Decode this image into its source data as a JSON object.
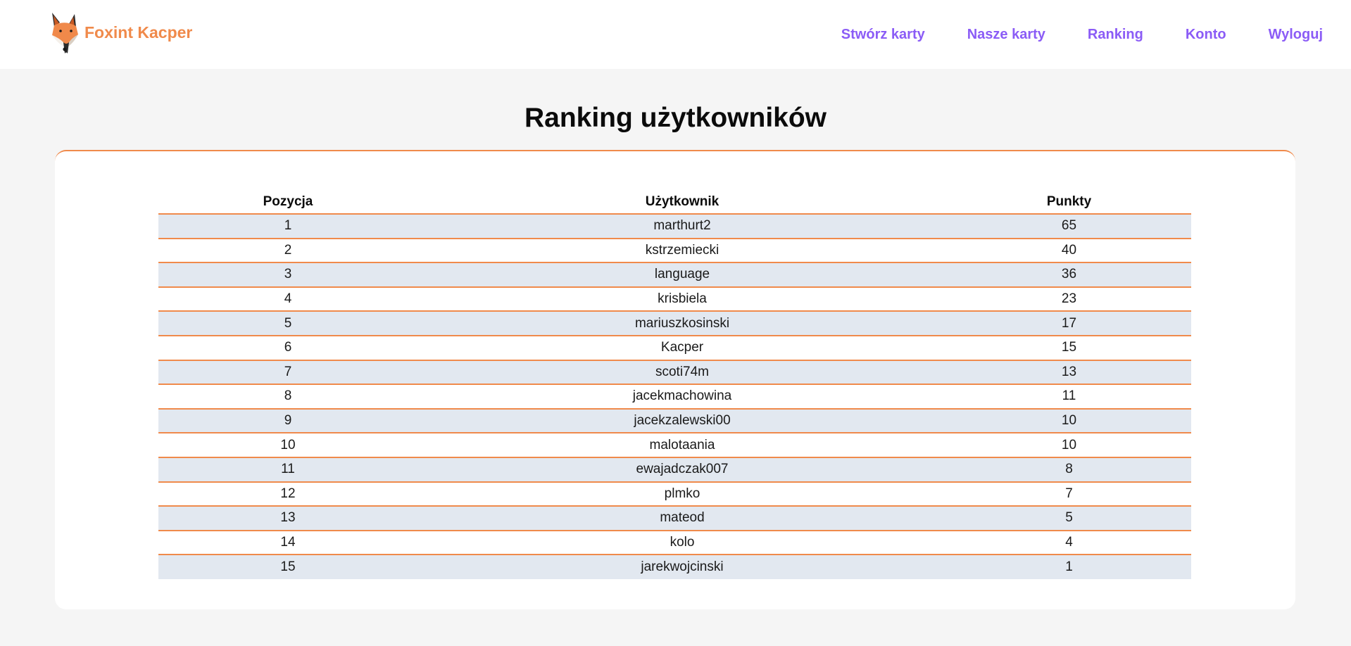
{
  "brand": {
    "name": "Foxint Kacper",
    "logo_icon": "fox-head-icon",
    "color": "#f08a4b"
  },
  "nav": {
    "links": [
      {
        "label": "Stwórz karty"
      },
      {
        "label": "Nasze karty"
      },
      {
        "label": "Ranking"
      },
      {
        "label": "Konto"
      },
      {
        "label": "Wyloguj"
      }
    ],
    "color": "#8b5cf6"
  },
  "main": {
    "title": "Ranking użytkowników",
    "table": {
      "headers": [
        "Pozycja",
        "Użytkownik",
        "Punkty"
      ],
      "rows": [
        [
          "1",
          "marthurt2",
          "65"
        ],
        [
          "2",
          "kstrzemiecki",
          "40"
        ],
        [
          "3",
          "language",
          "36"
        ],
        [
          "4",
          "krisbiela",
          "23"
        ],
        [
          "5",
          "mariuszkosinski",
          "17"
        ],
        [
          "6",
          "Kacper",
          "15"
        ],
        [
          "7",
          "scoti74m",
          "13"
        ],
        [
          "8",
          "jacekmachowina",
          "11"
        ],
        [
          "9",
          "jacekzalewski00",
          "10"
        ],
        [
          "10",
          "malotaania",
          "10"
        ],
        [
          "11",
          "ewajadczak007",
          "8"
        ],
        [
          "12",
          "plmko",
          "7"
        ],
        [
          "13",
          "mateod",
          "5"
        ],
        [
          "14",
          "kolo",
          "4"
        ],
        [
          "15",
          "jarekwojcinski",
          "1"
        ]
      ]
    },
    "accent_color": "#f08a4b",
    "stripe_color": "#e2e8f0"
  }
}
